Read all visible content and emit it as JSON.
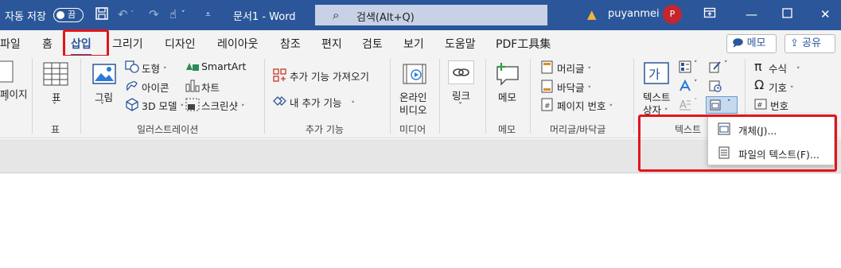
{
  "titlebar": {
    "autosave_label": "자동 저장",
    "toggle_state": "끔",
    "doc_title": "문서1  -  Word",
    "search_placeholder": "검색(Alt+Q)",
    "username": "puyanmei",
    "avatar_initial": "P"
  },
  "tabs": [
    "파일",
    "홈",
    "삽입",
    "그리기",
    "디자인",
    "레이아웃",
    "참조",
    "편지",
    "검토",
    "보기",
    "도움말",
    "PDF工具集"
  ],
  "active_tab": "삽입",
  "header_buttons": {
    "memo": "메모",
    "share": "공유"
  },
  "ribbon": {
    "pages": {
      "label": "페이지",
      "chevron": "˅"
    },
    "table": {
      "button": "표",
      "group": "표",
      "chevron": "˅"
    },
    "illustrations": {
      "group": "일러스트레이션",
      "picture": "그림",
      "shapes": "도형",
      "icons": "아이콘",
      "models3d": "3D 모델",
      "smartart": "SmartArt",
      "chart": "차트",
      "screenshot": "스크린샷"
    },
    "addins": {
      "group": "추가 기능",
      "get": "추가 기능 가져오기",
      "my": "내 추가 기능"
    },
    "media": {
      "group": "미디어",
      "online_video_1": "온라인",
      "online_video_2": "비디오"
    },
    "links": {
      "link": "링크"
    },
    "comments": {
      "group": "메모",
      "comment": "메모"
    },
    "header_footer": {
      "group": "머리글/바닥글",
      "header": "머리글",
      "footer": "바닥글",
      "page_number": "페이지 번호"
    },
    "text": {
      "group": "텍스트",
      "textbox_1": "텍스트",
      "textbox_2": "상자"
    },
    "symbols": {
      "equation": "수식",
      "symbol": "기호",
      "number": "번호"
    }
  },
  "object_menu": {
    "items": [
      {
        "label": "개체(J)...",
        "icon": "object-icon"
      },
      {
        "label": "파일의 텍스트(F)...",
        "icon": "text-from-file-icon"
      }
    ]
  },
  "colors": {
    "word_blue": "#2b579a",
    "highlight_red": "#e3141b"
  }
}
